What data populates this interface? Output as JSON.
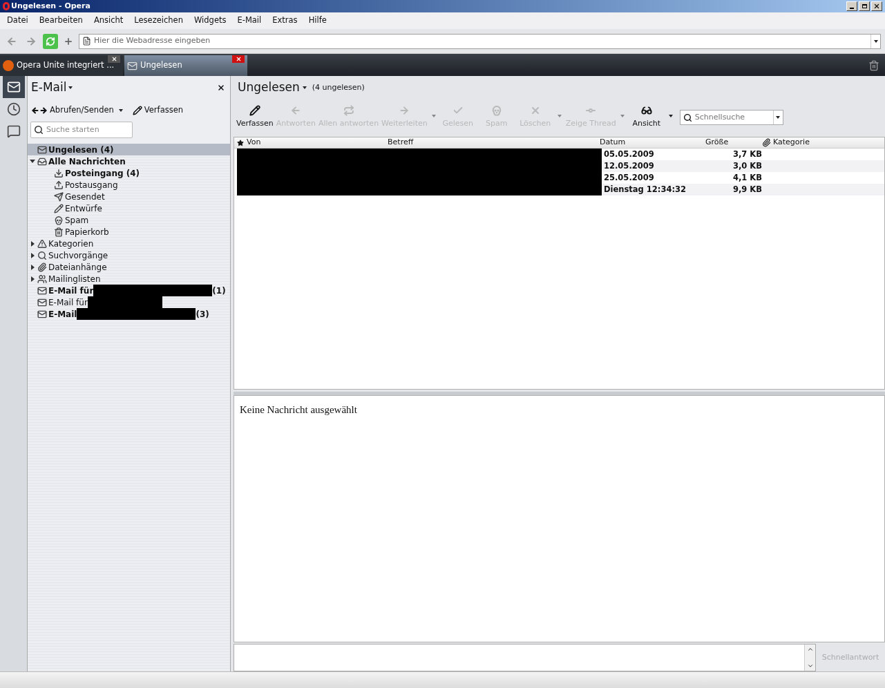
{
  "window": {
    "title": "Ungelesen - Opera"
  },
  "menu": [
    "Datei",
    "Bearbeiten",
    "Ansicht",
    "Lesezeichen",
    "Widgets",
    "E-Mail",
    "Extras",
    "Hilfe"
  ],
  "address_bar": {
    "placeholder": "Hier die Webadresse eingeben"
  },
  "tabs": [
    {
      "label": "Opera Unite integriert ...",
      "kind": "web",
      "selected": false
    },
    {
      "label": "Ungelesen",
      "kind": "mail",
      "selected": true
    }
  ],
  "side_strip": [
    {
      "kind": "mail",
      "selected": true
    },
    {
      "kind": "history",
      "selected": false
    },
    {
      "kind": "chat",
      "selected": false
    }
  ],
  "panel": {
    "title": "E-Mail",
    "actions": [
      {
        "kind": "fetch",
        "label": "Abrufen/Senden",
        "dropdown": true
      },
      {
        "kind": "compose",
        "label": "Verfassen",
        "dropdown": false
      }
    ],
    "search": {
      "placeholder": "Suche starten"
    },
    "folders": [
      {
        "kind": "unread",
        "label": "Ungelesen (4)",
        "unread": true,
        "selected": true
      },
      {
        "kind": "all",
        "label": "Alle Nachrichten",
        "unread": true,
        "selected": false,
        "expanded": true,
        "children": [
          {
            "kind": "inbox",
            "label": "Posteingang (4)",
            "unread": true,
            "selected": false
          },
          {
            "kind": "outbox",
            "label": "Postausgang",
            "unread": false,
            "selected": false
          },
          {
            "kind": "sent",
            "label": "Gesendet",
            "unread": false,
            "selected": false
          },
          {
            "kind": "drafts",
            "label": "Entwürfe",
            "unread": false,
            "selected": false
          },
          {
            "kind": "spam",
            "label": "Spam",
            "unread": false,
            "selected": false
          },
          {
            "kind": "trash",
            "label": "Papierkorb",
            "unread": false,
            "selected": false
          }
        ]
      },
      {
        "kind": "labels",
        "label": "Kategorien",
        "unread": false,
        "selected": false,
        "expanded": false
      },
      {
        "kind": "search",
        "label": "Suchvorgänge",
        "unread": false,
        "selected": false,
        "expanded": false
      },
      {
        "kind": "attachments",
        "label": "Dateianhänge",
        "unread": false,
        "selected": false,
        "expanded": false
      },
      {
        "kind": "lists",
        "label": "Mailinglisten",
        "unread": false,
        "selected": false,
        "expanded": false
      },
      {
        "kind": "account",
        "label": "E-Mail für",
        "count": "(1)",
        "unread": true,
        "selected": false
      },
      {
        "kind": "account",
        "label": "E-Mail für",
        "unread": false,
        "selected": false
      },
      {
        "kind": "account",
        "label": "E-Mail",
        "count": "(3)",
        "unread": true,
        "selected": false
      }
    ]
  },
  "view": {
    "title": "Ungelesen",
    "subtitle": "(4 ungelesen)",
    "toolbar": [
      {
        "kind": "compose",
        "label": "Verfassen",
        "disabled": false,
        "dropdown": false
      },
      {
        "kind": "reply",
        "label": "Antworten",
        "disabled": true,
        "dropdown": false
      },
      {
        "kind": "reply_all",
        "label": "Allen antworten",
        "disabled": true,
        "dropdown": false
      },
      {
        "kind": "forward",
        "label": "Weiterleiten",
        "disabled": true,
        "dropdown": true
      },
      {
        "kind": "read",
        "label": "Gelesen",
        "disabled": true,
        "dropdown": false
      },
      {
        "kind": "spam",
        "label": "Spam",
        "disabled": true,
        "dropdown": false
      },
      {
        "kind": "delete",
        "label": "Löschen",
        "disabled": true,
        "dropdown": true
      },
      {
        "kind": "thread",
        "label": "Zeige Thread",
        "disabled": true,
        "dropdown": true
      },
      {
        "kind": "view",
        "label": "Ansicht",
        "disabled": false,
        "dropdown": true
      }
    ],
    "quick_search": {
      "placeholder": "Schnellsuche"
    },
    "table": {
      "columns": [
        "Von",
        "Betreff",
        "Datum",
        "Größe",
        "Kategorie"
      ],
      "rows": [
        {
          "datum": "05.05.2009",
          "groesse": "3,7 KB",
          "unread": true
        },
        {
          "datum": "12.05.2009",
          "groesse": "3,0 KB",
          "unread": true
        },
        {
          "datum": "25.05.2009",
          "groesse": "4,1 KB",
          "unread": true
        },
        {
          "datum": "Dienstag 12:34:32",
          "groesse": "9,9 KB",
          "unread": true
        }
      ]
    },
    "preview": {
      "message": "Keine Nachricht ausgewählt"
    },
    "quick_reply": {
      "button": "Schnellantwort",
      "disabled": true
    }
  }
}
